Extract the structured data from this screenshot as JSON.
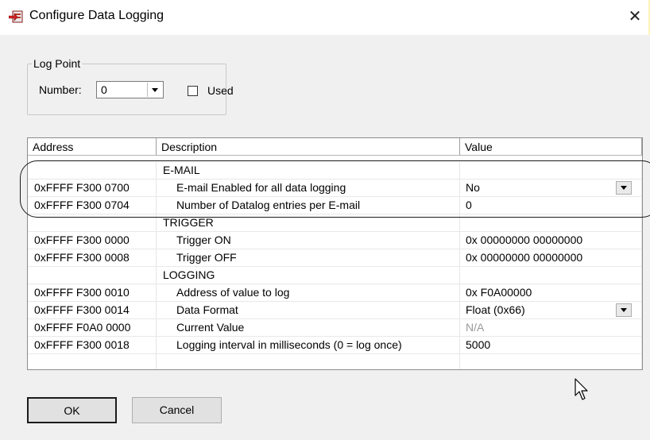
{
  "window": {
    "title": "Configure Data Logging",
    "icon": "data-logging-icon",
    "close_glyph": "✕"
  },
  "log_point": {
    "group_label": "Log Point",
    "number_label": "Number:",
    "number_value": "0",
    "used_label": "Used",
    "used_checked": false
  },
  "table": {
    "columns": [
      "Address",
      "Description",
      "Value"
    ],
    "rows": [
      {
        "address": "",
        "description": "E-MAIL",
        "value": ""
      },
      {
        "address": "0xFFFF F300 0700",
        "description": "E-mail Enabled for all data logging",
        "value": "No"
      },
      {
        "address": "0xFFFF F300 0704",
        "description": "Number of Datalog entries per E-mail",
        "value": "0"
      },
      {
        "address": "",
        "description": "TRIGGER",
        "value": ""
      },
      {
        "address": "0xFFFF F300 0000",
        "description": "Trigger ON",
        "value": "0x 00000000  00000000"
      },
      {
        "address": "0xFFFF F300 0008",
        "description": "Trigger OFF",
        "value": "0x 00000000  00000000"
      },
      {
        "address": "",
        "description": "LOGGING",
        "value": ""
      },
      {
        "address": "0xFFFF F300 0010",
        "description": "Address of value to log",
        "value": "0x F0A00000"
      },
      {
        "address": "0xFFFF F300 0014",
        "description": "Data Format",
        "value": "Float (0x66)"
      },
      {
        "address": "0xFFFF F0A0 0000",
        "description": "Current Value",
        "value": "N/A"
      },
      {
        "address": "0xFFFF F300 0018",
        "description": "Logging interval in milliseconds (0 = log once)",
        "value": "5000"
      }
    ]
  },
  "buttons": {
    "ok": "OK",
    "cancel": "Cancel"
  },
  "colors": {
    "highlight_outline": "#1a1a1a",
    "window_bg": "#f0f0f0",
    "muted_value": "#9a9a9a"
  }
}
